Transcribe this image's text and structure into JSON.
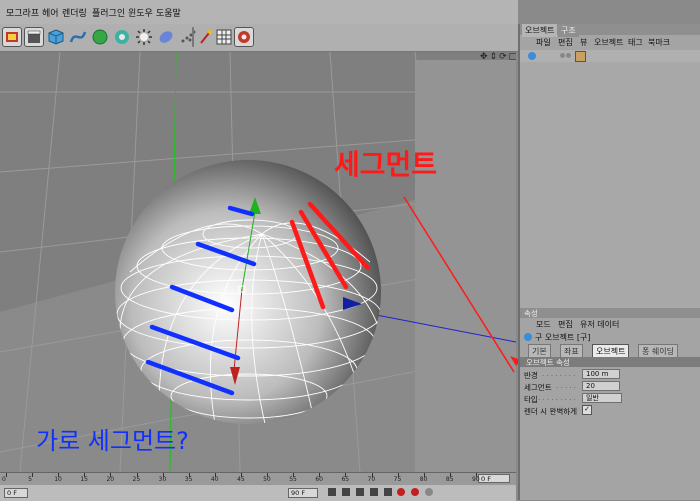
{
  "menu": [
    "모그라프",
    "헤어",
    "렌더링",
    "플러그인",
    "윈도우",
    "도움말"
  ],
  "right_panel": {
    "top_tabs": [
      "오브젝트",
      "구조"
    ],
    "top_menu": [
      "파일",
      "편집",
      "뷰",
      "오브젝트",
      "태그",
      "북마크"
    ],
    "attr_header": "속성",
    "attr_menu": [
      "모드",
      "편집",
      "유저 데이터"
    ],
    "object_title": "구 오브젝트 [구]",
    "attr_tabs": [
      "기본",
      "좌표",
      "오브젝트",
      "퐁 쉐이딩"
    ],
    "section": "오브젝트 속성",
    "fields": [
      {
        "label": "반경",
        "value": "100 m"
      },
      {
        "label": "세그먼트",
        "value": "20"
      },
      {
        "label": "타입",
        "value": "일반"
      }
    ],
    "checkbox_label": "렌더 시 완벽하게"
  },
  "annotations": {
    "red_label": "세그먼트",
    "blue_label": "가로 세그먼트?"
  },
  "timeline": {
    "ticks": [
      "0",
      "5",
      "10",
      "15",
      "20",
      "25",
      "30",
      "35",
      "40",
      "45",
      "50",
      "55",
      "60",
      "65",
      "70",
      "75",
      "80",
      "85",
      "90"
    ],
    "frame_left": "0 F",
    "frame_right": "0 F",
    "frame_mid": "90 F"
  },
  "colors": {
    "annotation_red": "#ff1a1a",
    "annotation_blue": "#1030ff",
    "viewport_bg": "#7f7f7f",
    "panel_bg": "#a4a4a4"
  }
}
